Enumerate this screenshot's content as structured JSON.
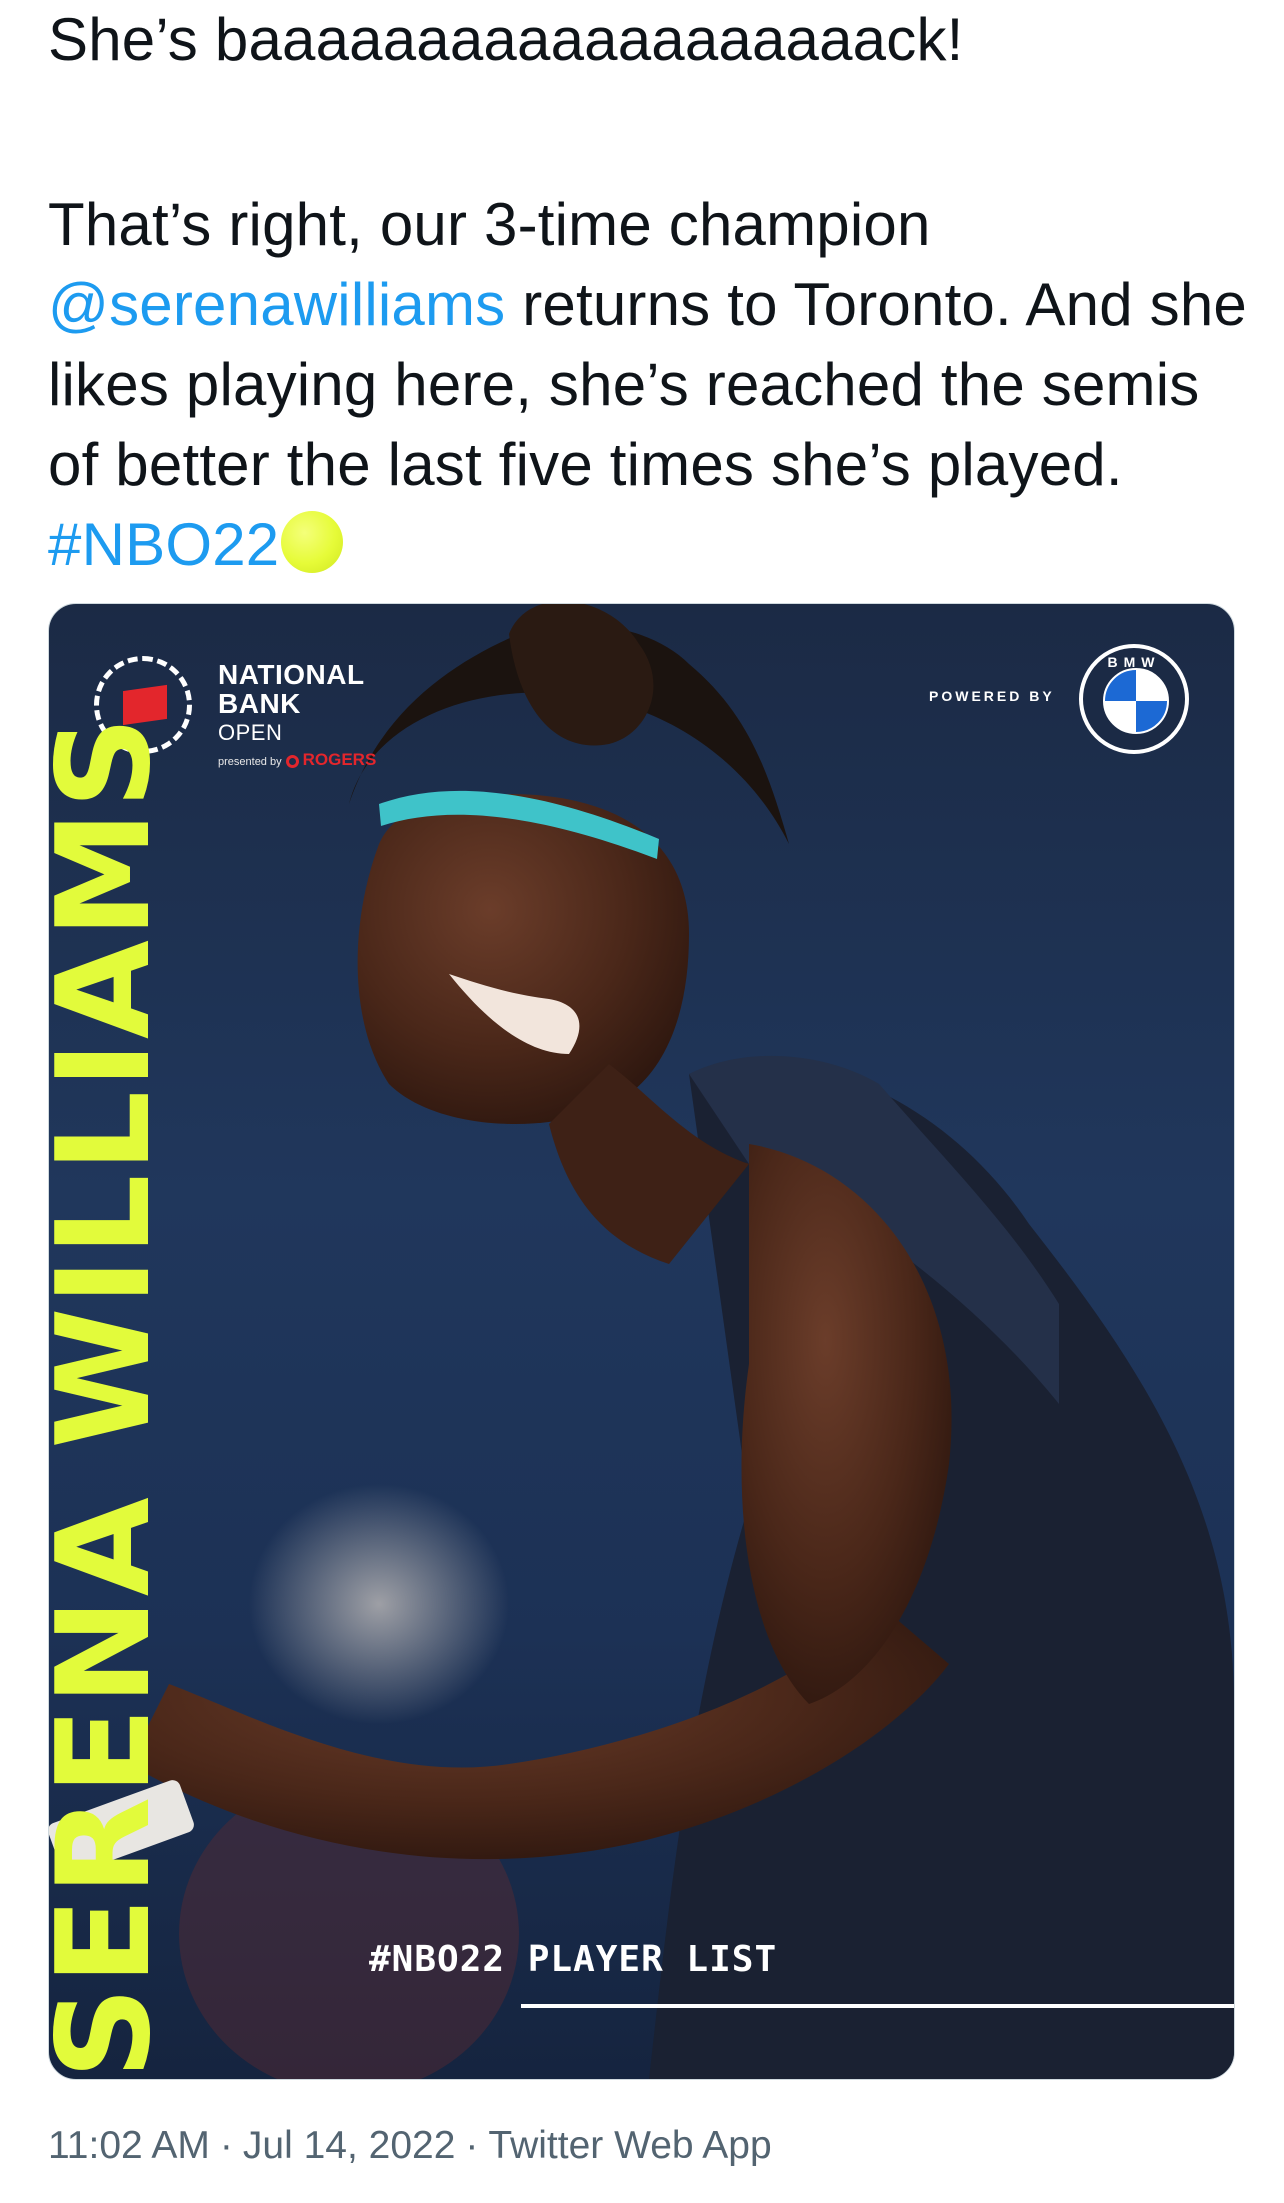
{
  "tweet": {
    "line1": "She’s baaaaaaaaaaaaaaaaaaack!",
    "para2_before": "That’s right, our 3-time champion ",
    "mention": "@serenawilliams",
    "para2_after": " returns to Toronto. And she likes playing here, she’s reached the semis of better the last five times she’s played. ",
    "hashtag": "#NBO22",
    "emoji": "tennis-ball-emoji"
  },
  "media": {
    "logo_lines": [
      "NATIONAL",
      "BANK",
      "OPEN"
    ],
    "presented_by": "presented by",
    "sponsor": "ROGERS",
    "powered_by": "POWERED BY",
    "bmw_letters": "BMW",
    "player_name": "SERENA WILLIAMS",
    "player_list": "#NBO22 PLAYER LIST",
    "accent_color": "#e2fb3b"
  },
  "meta": {
    "time": "11:02 AM",
    "date": "Jul 14, 2022",
    "source": "Twitter Web App",
    "separator": "·"
  }
}
